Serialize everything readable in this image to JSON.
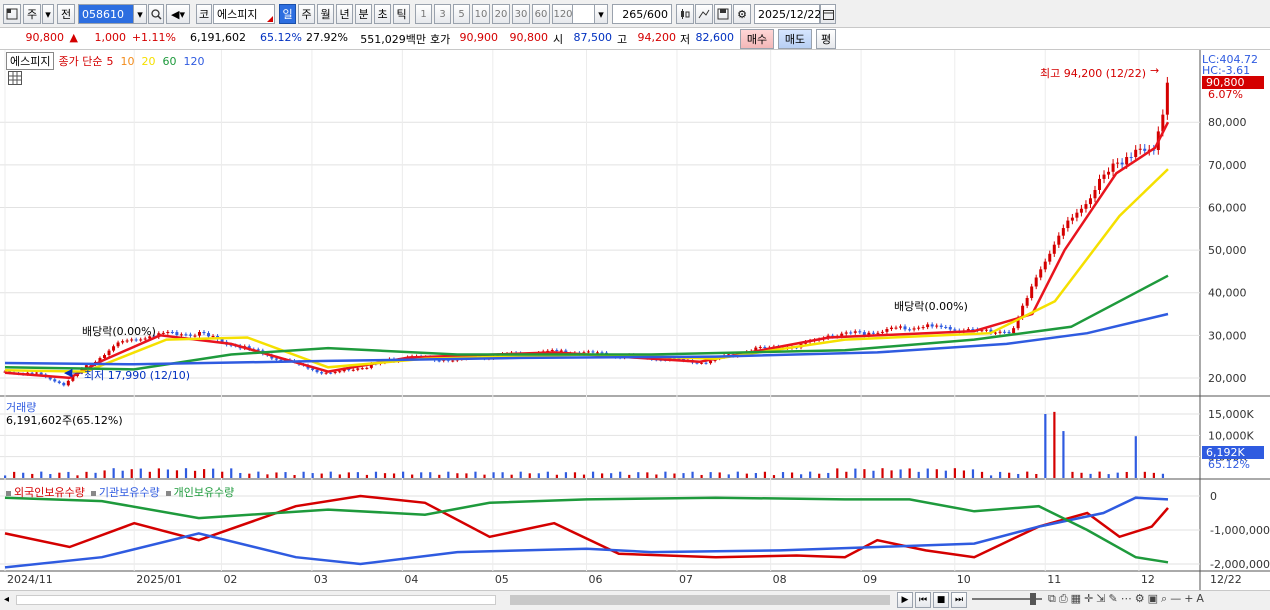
{
  "toolbar": {
    "period_main": "주",
    "jeon_label": "전",
    "code": "058610",
    "market_tag": "코",
    "stock_name": "에스피지",
    "periods": [
      "일",
      "주",
      "월",
      "년",
      "분",
      "초",
      "틱"
    ],
    "active_period": "일",
    "intervals": [
      "1",
      "3",
      "5",
      "10",
      "20",
      "30",
      "60",
      "120"
    ],
    "count": "265",
    "count_total": "/600",
    "date": "2025/12/22"
  },
  "quote": {
    "price": "90,800",
    "change_arrow": "▲",
    "change": "1,000",
    "change_pct": "+1.11%",
    "volume": "6,191,602",
    "vol_ratio": "65.12%",
    "turnover_pct": "27.92%",
    "amount": "551,029백만",
    "hoga_label": "호가",
    "ask": "90,900",
    "bid": "90,800",
    "open_label": "시",
    "open": "87,500",
    "high_label": "고",
    "high": "94,200",
    "low_label": "저",
    "low": "82,600",
    "buy_btn": "매수",
    "sell_btn": "매도",
    "avg_btn": "평"
  },
  "price_panel": {
    "name_tag": "에스피지",
    "legend_main": "종가 단순",
    "ma_periods": [
      "5",
      "10",
      "20",
      "60",
      "120"
    ],
    "ma_colors": [
      "#e8141e",
      "#f28c1c",
      "#f5e000",
      "#1e9a3c",
      "#2f5be0"
    ],
    "lc": "LC:404.72",
    "hc": "HC:-3.61",
    "last_price_box": "90,800",
    "last_pct": "6.07%",
    "annot_high": "최고 94,200 (12/22)",
    "annot_low": "최저 17,990 (12/10)",
    "annot_div1": "배당락(0.00%)",
    "annot_div2": "배당락(0.00%)",
    "y_ticks": [
      "80,000",
      "70,000",
      "60,000",
      "50,000",
      "40,000",
      "30,000",
      "20,000"
    ]
  },
  "volume_panel": {
    "title": "거래량",
    "value": "6,191,602주(65.12%)",
    "y_ticks": [
      "15,000K",
      "10,000K",
      "5,000K"
    ],
    "last_box": "6,192K",
    "last_pct": "65.12%"
  },
  "holding_panel": {
    "legend": [
      "외국인보유수량",
      "기관보유수량",
      "개인보유수량"
    ],
    "legend_colors": [
      "#d40000",
      "#2f5be0",
      "#1e9a3c"
    ],
    "y_ticks": [
      "0",
      "-1,000,000",
      "-2,000,000"
    ]
  },
  "x_axis": {
    "labels": [
      "2024/11",
      "2025/01",
      "02",
      "03",
      "04",
      "05",
      "06",
      "07",
      "08",
      "09",
      "10",
      "11",
      "12",
      "12/22"
    ]
  },
  "chart_data": {
    "type": "candlestick",
    "title": "에스피지",
    "x_range": [
      "2024/11",
      "2025/12/22"
    ],
    "price_ylim": [
      16000,
      96000
    ],
    "series": [
      {
        "name": "종가",
        "points": [
          [
            0,
            21500
          ],
          [
            10,
            21000
          ],
          [
            18,
            18500
          ],
          [
            25,
            22500
          ],
          [
            35,
            28000
          ],
          [
            48,
            30500
          ],
          [
            60,
            30500
          ],
          [
            72,
            27500
          ],
          [
            85,
            24500
          ],
          [
            100,
            21000
          ],
          [
            112,
            22800
          ],
          [
            125,
            25000
          ],
          [
            140,
            24200
          ],
          [
            155,
            25500
          ],
          [
            170,
            26200
          ],
          [
            185,
            25500
          ],
          [
            200,
            24800
          ],
          [
            215,
            23500
          ],
          [
            230,
            26500
          ],
          [
            245,
            27500
          ],
          [
            255,
            30000
          ],
          [
            265,
            30500
          ],
          [
            275,
            31500
          ],
          [
            285,
            32000
          ],
          [
            300,
            31000
          ],
          [
            312,
            31000
          ],
          [
            320,
            45000
          ],
          [
            328,
            55000
          ],
          [
            336,
            63000
          ],
          [
            344,
            70000
          ],
          [
            350,
            74000
          ],
          [
            356,
            72000
          ],
          [
            360,
            90800
          ]
        ]
      },
      {
        "name": "MA5",
        "points": [
          [
            0,
            21200
          ],
          [
            20,
            20000
          ],
          [
            30,
            24000
          ],
          [
            48,
            30000
          ],
          [
            70,
            28000
          ],
          [
            100,
            21500
          ],
          [
            125,
            24800
          ],
          [
            170,
            26000
          ],
          [
            215,
            23800
          ],
          [
            255,
            29500
          ],
          [
            300,
            31000
          ],
          [
            318,
            35000
          ],
          [
            328,
            50000
          ],
          [
            344,
            68000
          ],
          [
            356,
            74000
          ],
          [
            360,
            80000
          ]
        ]
      },
      {
        "name": "MA20",
        "points": [
          [
            0,
            21800
          ],
          [
            25,
            21500
          ],
          [
            50,
            29000
          ],
          [
            75,
            29500
          ],
          [
            100,
            22500
          ],
          [
            130,
            24500
          ],
          [
            180,
            25500
          ],
          [
            220,
            24500
          ],
          [
            260,
            29000
          ],
          [
            305,
            30500
          ],
          [
            325,
            38000
          ],
          [
            345,
            58000
          ],
          [
            360,
            69000
          ]
        ]
      },
      {
        "name": "MA60",
        "points": [
          [
            0,
            22500
          ],
          [
            40,
            22000
          ],
          [
            70,
            25500
          ],
          [
            100,
            27000
          ],
          [
            140,
            25500
          ],
          [
            200,
            25500
          ],
          [
            260,
            26500
          ],
          [
            300,
            29000
          ],
          [
            330,
            32000
          ],
          [
            360,
            44000
          ]
        ]
      },
      {
        "name": "MA120",
        "points": [
          [
            0,
            23500
          ],
          [
            40,
            23200
          ],
          [
            100,
            24000
          ],
          [
            160,
            24700
          ],
          [
            220,
            25000
          ],
          [
            270,
            26000
          ],
          [
            310,
            28000
          ],
          [
            335,
            30500
          ],
          [
            360,
            35000
          ]
        ]
      }
    ],
    "holdings": [
      {
        "name": "외국인보유수량",
        "points": [
          [
            0,
            -1100000
          ],
          [
            20,
            -1500000
          ],
          [
            40,
            -800000
          ],
          [
            60,
            -1300000
          ],
          [
            90,
            -300000
          ],
          [
            110,
            0
          ],
          [
            130,
            -200000
          ],
          [
            150,
            -1200000
          ],
          [
            170,
            -800000
          ],
          [
            190,
            -1700000
          ],
          [
            220,
            -1800000
          ],
          [
            245,
            -1750000
          ],
          [
            260,
            -1800000
          ],
          [
            270,
            -1300000
          ],
          [
            285,
            -1600000
          ],
          [
            300,
            -1800000
          ],
          [
            320,
            -900000
          ],
          [
            335,
            -500000
          ],
          [
            345,
            -1200000
          ],
          [
            355,
            -900000
          ],
          [
            360,
            -350000
          ]
        ]
      },
      {
        "name": "기관보유수량",
        "points": [
          [
            0,
            -2100000
          ],
          [
            30,
            -1800000
          ],
          [
            60,
            -1100000
          ],
          [
            90,
            -1800000
          ],
          [
            110,
            -2000000
          ],
          [
            140,
            -1650000
          ],
          [
            180,
            -1550000
          ],
          [
            200,
            -1650000
          ],
          [
            240,
            -1600000
          ],
          [
            270,
            -1500000
          ],
          [
            300,
            -1400000
          ],
          [
            320,
            -900000
          ],
          [
            340,
            -500000
          ],
          [
            350,
            -50000
          ],
          [
            360,
            -100000
          ]
        ]
      },
      {
        "name": "개인보유수량",
        "points": [
          [
            0,
            -50000
          ],
          [
            30,
            -150000
          ],
          [
            60,
            -650000
          ],
          [
            100,
            -400000
          ],
          [
            130,
            -550000
          ],
          [
            150,
            -200000
          ],
          [
            180,
            -100000
          ],
          [
            220,
            -50000
          ],
          [
            260,
            -100000
          ],
          [
            280,
            -100000
          ],
          [
            300,
            -450000
          ],
          [
            320,
            -300000
          ],
          [
            335,
            -1000000
          ],
          [
            350,
            -1800000
          ],
          [
            360,
            -1950000
          ]
        ]
      }
    ],
    "volume_peaks_k": [
      {
        "x": 322,
        "v": 15000
      },
      {
        "x": 324,
        "v": 15500
      },
      {
        "x": 328,
        "v": 11000
      },
      {
        "x": 350,
        "v": 9800
      },
      {
        "x": 360,
        "v": 6192
      }
    ],
    "annotations": [
      {
        "text": "최고 94,200 (12/22)"
      },
      {
        "text": "최저 17,990 (12/10)"
      },
      {
        "text": "배당락(0.00%)"
      },
      {
        "text": "배당락(0.00%)"
      }
    ]
  }
}
